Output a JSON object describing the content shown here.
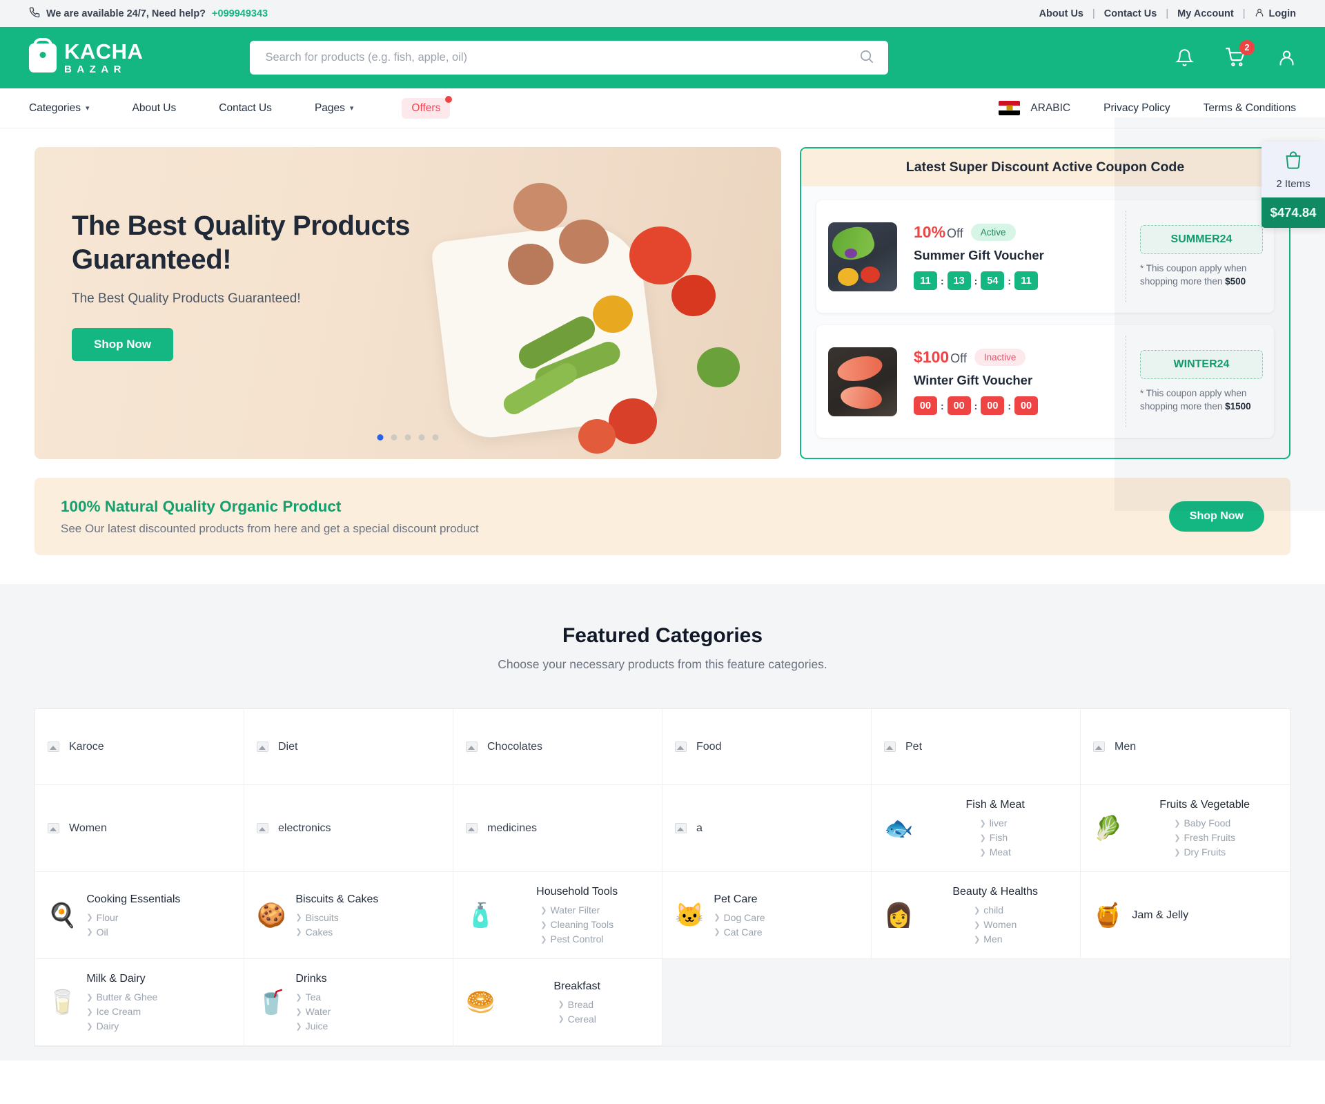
{
  "topbar": {
    "phone_icon": "phone-icon",
    "help_text": "We are available 24/7, Need help?",
    "phone": "+099949343",
    "about": "About Us",
    "contact": "Contact Us",
    "my_account": "My Account",
    "login": "Login"
  },
  "header": {
    "logo_main": "KACHA",
    "logo_sub": "BAZAR",
    "search_placeholder": "Search for products (e.g. fish, apple, oil)",
    "search_value": "",
    "cart_badge": "2"
  },
  "nav": {
    "categories": "Categories",
    "about": "About Us",
    "contact": "Contact Us",
    "pages": "Pages",
    "offers": "Offers",
    "language": "ARABIC",
    "privacy": "Privacy Policy",
    "terms": "Terms & Conditions"
  },
  "hero": {
    "title": "The Best Quality Products Guaranteed!",
    "subtitle": "The Best Quality Products Guaranteed!",
    "button": "Shop Now",
    "slide_count": 5,
    "active_slide": 1
  },
  "coupons": {
    "header": "Latest Super Discount Active Coupon Code",
    "items": [
      {
        "discount": "10%",
        "off_label": "Off",
        "status": "Active",
        "status_type": "active",
        "name": "Summer Gift Voucher",
        "timer": [
          "11",
          "13",
          "54",
          "11"
        ],
        "timer_color": "#14b681",
        "code": "SUMMER24",
        "note_prefix": "* This coupon apply when shopping more then ",
        "note_amount": "$500",
        "image": "peppers-image"
      },
      {
        "discount": "$100",
        "off_label": "Off",
        "status": "Inactive",
        "status_type": "inactive",
        "name": "Winter Gift Voucher",
        "timer": [
          "00",
          "00",
          "00",
          "00"
        ],
        "timer_color": "#ef4444",
        "code": "WINTER24",
        "note_prefix": "* This coupon apply when shopping more then ",
        "note_amount": "$1500",
        "image": "salmon-image"
      }
    ]
  },
  "promo": {
    "title": "100% Natural Quality Organic Product",
    "subtitle": "See Our latest discounted products from here and get a special discount product",
    "button": "Shop Now"
  },
  "featured": {
    "title": "Featured Categories",
    "subtitle": "Choose your necessary products from this feature categories.",
    "cells": [
      {
        "type": "simple",
        "name": "Karoce",
        "icon": "broken-image-icon"
      },
      {
        "type": "simple",
        "name": "Diet",
        "icon": "broken-image-icon"
      },
      {
        "type": "simple",
        "name": "Chocolates",
        "icon": "broken-image-icon"
      },
      {
        "type": "simple",
        "name": "Food",
        "icon": "broken-image-icon"
      },
      {
        "type": "simple",
        "name": "Pet",
        "icon": "broken-image-icon"
      },
      {
        "type": "simple",
        "name": "Men",
        "icon": "broken-image-icon"
      },
      {
        "type": "simple",
        "name": "Women",
        "icon": "broken-image-icon"
      },
      {
        "type": "simple",
        "name": "electronics",
        "icon": "broken-image-icon"
      },
      {
        "type": "simple",
        "name": "medicines",
        "icon": "broken-image-icon"
      },
      {
        "type": "simple",
        "name": "a",
        "icon": "broken-image-icon"
      },
      {
        "type": "rich",
        "name": "Fish & Meat",
        "emoji": "🐟",
        "subs": [
          "liver",
          "Fish",
          "Meat"
        ]
      },
      {
        "type": "rich",
        "name": "Fruits & Vegetable",
        "emoji": "🥬",
        "subs": [
          "Baby Food",
          "Fresh Fruits",
          "Dry Fruits"
        ]
      },
      {
        "type": "inline",
        "name": "Cooking Essentials",
        "emoji": "🍳",
        "subs": [
          "Flour",
          "Oil"
        ]
      },
      {
        "type": "inline",
        "name": "Biscuits & Cakes",
        "emoji": "🍪",
        "subs": [
          "Biscuits",
          "Cakes"
        ]
      },
      {
        "type": "rich",
        "name": "Household Tools",
        "emoji": "🧴",
        "subs": [
          "Water Filter",
          "Cleaning Tools",
          "Pest Control"
        ]
      },
      {
        "type": "inline",
        "name": "Pet Care",
        "emoji": "🐱",
        "subs": [
          "Dog Care",
          "Cat Care"
        ]
      },
      {
        "type": "rich",
        "name": "Beauty & Healths",
        "emoji": "👩",
        "subs": [
          "child",
          "Women",
          "Men"
        ]
      },
      {
        "type": "label-only",
        "name": "Jam & Jelly",
        "emoji": "🍯",
        "subs": []
      },
      {
        "type": "inline",
        "name": "Milk & Dairy",
        "emoji": "🥛",
        "subs": [
          "Butter & Ghee",
          "Ice Cream",
          "Dairy"
        ]
      },
      {
        "type": "inline",
        "name": "Drinks",
        "emoji": "🥤",
        "subs": [
          "Tea",
          "Water",
          "Juice"
        ]
      },
      {
        "type": "rich",
        "name": "Breakfast",
        "emoji": "🥯",
        "subs": [
          "Bread",
          "Cereal"
        ]
      },
      {
        "type": "empty",
        "name": "",
        "subs": []
      },
      {
        "type": "empty",
        "name": "",
        "subs": []
      },
      {
        "type": "empty",
        "name": "",
        "subs": []
      }
    ]
  },
  "float_cart": {
    "icon": "shopping-bag-icon",
    "items_label": "2 Items",
    "total": "$474.84"
  }
}
